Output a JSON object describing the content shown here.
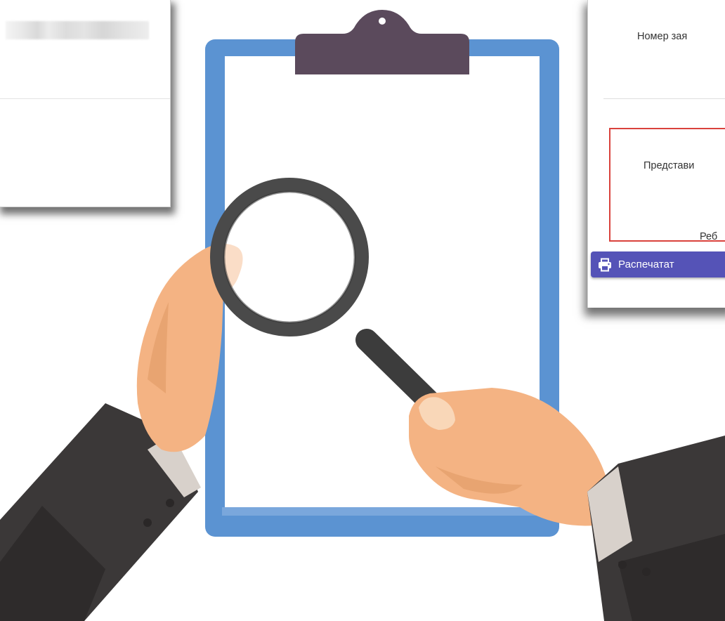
{
  "right_panel": {
    "number_label": "Номер зая",
    "representative_label": "Представи",
    "cut_label": "Реб"
  },
  "print_button": {
    "label": "Распечатат",
    "icon": "printer-icon"
  },
  "colors": {
    "clipboard_border": "#5b93d2",
    "clip": "#5b4a5c",
    "highlight_box": "#d9423c",
    "print_button": "#5553b7",
    "sleeve": "#3b3838",
    "skin": "#f4b383"
  }
}
